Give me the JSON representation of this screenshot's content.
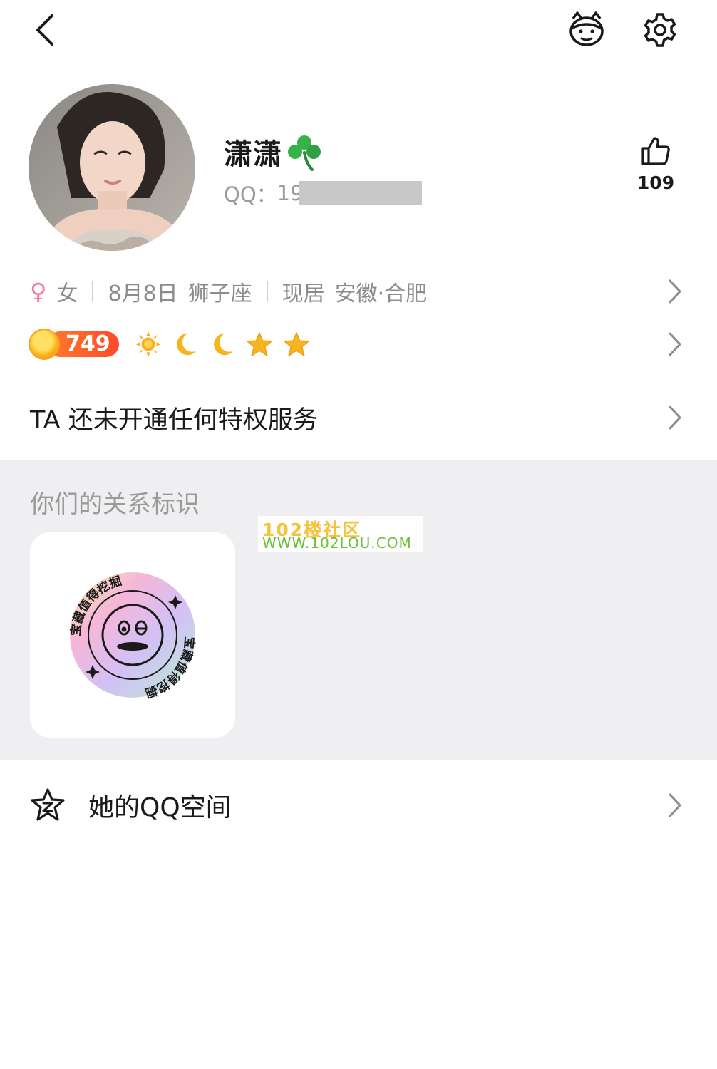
{
  "topbar": {
    "back_icon": "chevron-left-icon",
    "pet_icon": "pet-face-icon",
    "settings_icon": "gear-icon"
  },
  "profile": {
    "name": "潇潇",
    "name_emoji": "☘️",
    "qq_label": "QQ：",
    "qq_visible": "19",
    "likes": "109",
    "like_icon": "thumbs-up-icon"
  },
  "info": {
    "gender_symbol": "♀",
    "gender": "女",
    "birthday": "8月8日",
    "zodiac": "狮子座",
    "location_label": "现居",
    "location": "安徽·合肥"
  },
  "level": {
    "value": "749",
    "icons": [
      "sun-icon",
      "moon-icon",
      "moon-icon",
      "star-icon",
      "star-icon"
    ]
  },
  "privilege": {
    "text": "TA 还未开通任何特权服务"
  },
  "relation": {
    "title": "你们的关系标识",
    "badge_text": "宝藏值得挖掘",
    "watermark_top": "102楼社区",
    "watermark_bottom": "WWW.102LOU.COM"
  },
  "qzone": {
    "label": "她的QQ空间",
    "icon": "qzone-star-icon"
  },
  "colors": {
    "level_pill": "#ff5a2a",
    "gender": "#f07aa6",
    "section_bg": "#efeff2"
  }
}
